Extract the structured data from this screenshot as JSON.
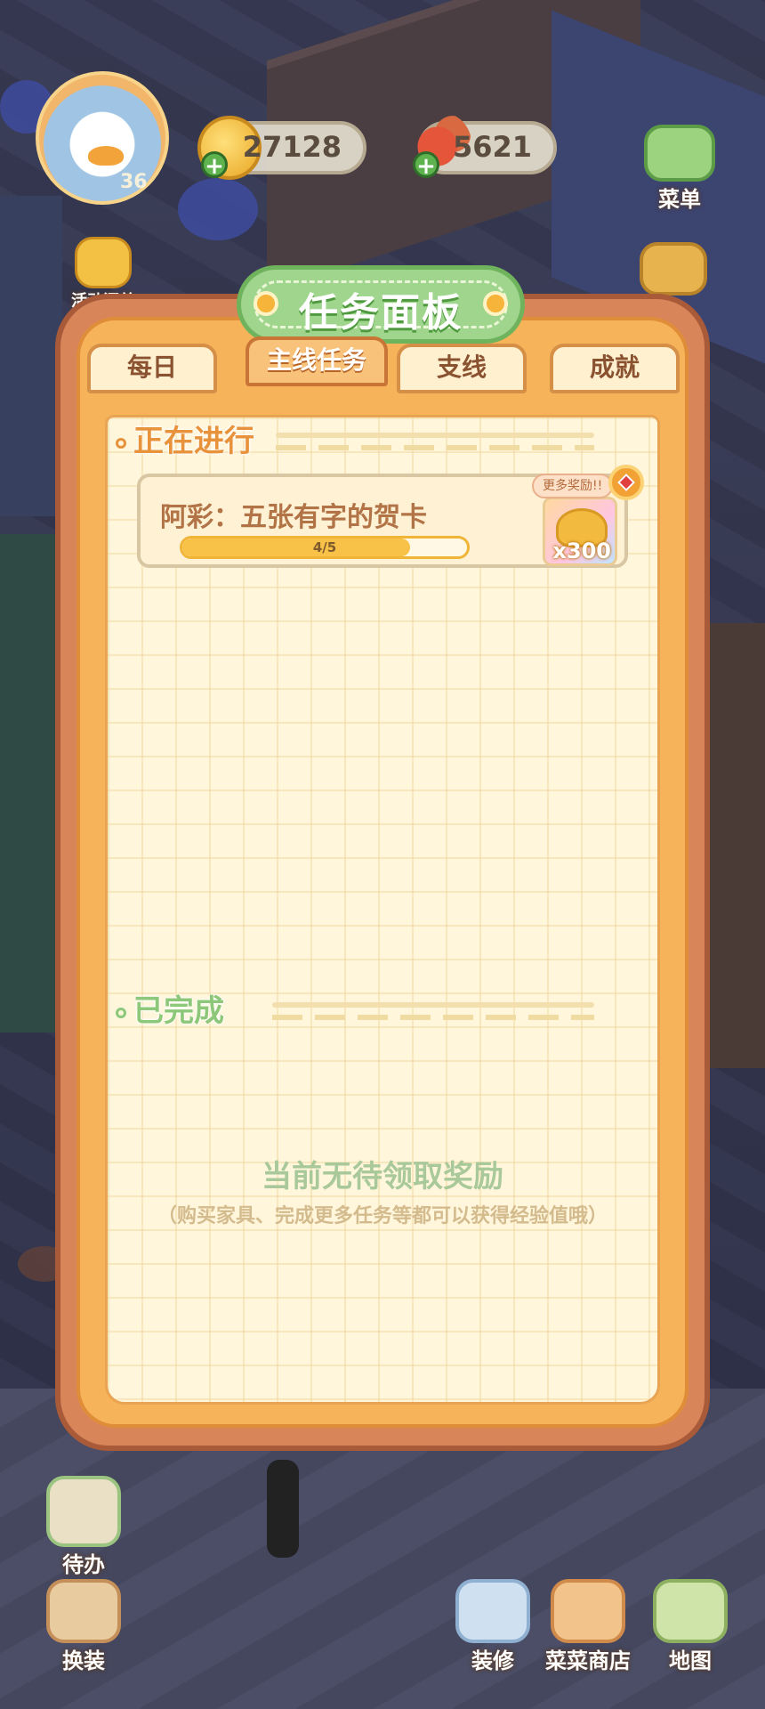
{
  "panel": {
    "title": "任务面板",
    "tabs": [
      {
        "label": "每日",
        "active": false
      },
      {
        "label": "主线任务",
        "active": true
      },
      {
        "label": "支线",
        "active": false
      },
      {
        "label": "成就",
        "active": false
      }
    ],
    "in_progress_heading": "正在进行",
    "task": {
      "title": "阿彩：五张有字的贺卡",
      "progress_text": "4/5",
      "progress_fraction": 0.8,
      "reward_qty": "x300",
      "more_rewards_tag": "更多奖励!!"
    },
    "completed_heading": "已完成",
    "empty_title": "当前无待领取奖励",
    "empty_subtitle": "（购买家具、完成更多任务等都可以获得经验值哦）"
  },
  "hud": {
    "level": "36",
    "coins": "27128",
    "veggies": "5621",
    "events_label": "活动汇总",
    "menu_label": "菜单",
    "todo_label": "待办",
    "dressup_label": "换装",
    "decorate_label": "装修",
    "shop_label": "菜菜商店",
    "map_label": "地图"
  },
  "colors": {
    "panel_orange": "#f7b35a",
    "title_green": "#9fd58c",
    "heading_orange": "#e8933b",
    "heading_green": "#8dc77a"
  }
}
